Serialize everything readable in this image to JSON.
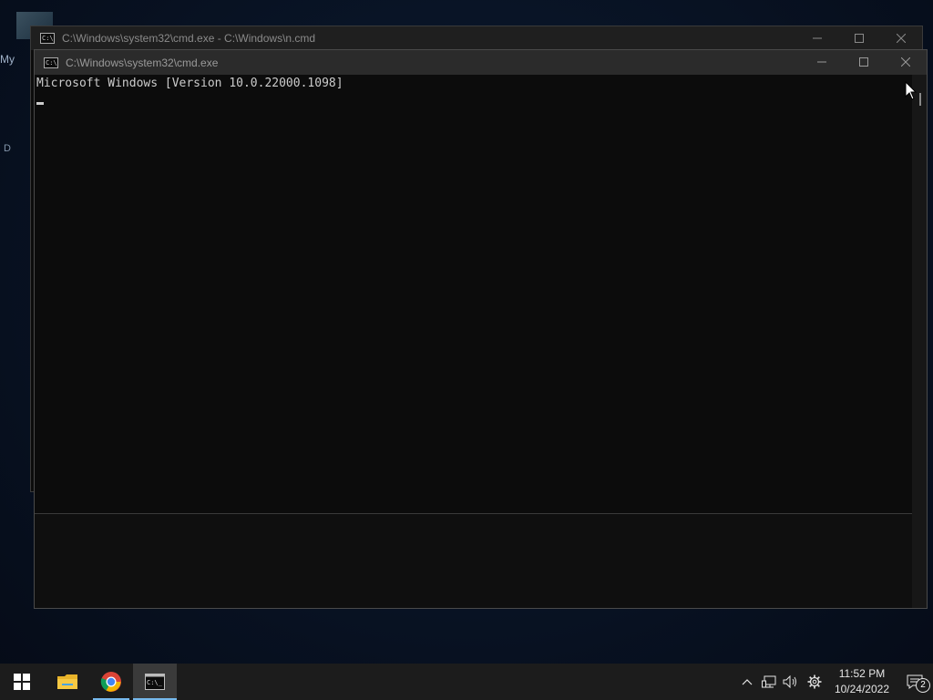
{
  "desktop": {
    "icon_label_1": "My",
    "icon_label_2": "D"
  },
  "back_window": {
    "title": "C:\\Windows\\system32\\cmd.exe - C:\\Windows\\n.cmd"
  },
  "front_window": {
    "title": "C:\\Windows\\system32\\cmd.exe",
    "console_lines": [
      "Microsoft Windows [Version 10.0.22000.1098]"
    ]
  },
  "taskbar": {
    "apps": [
      {
        "icon": "windows-start-icon"
      },
      {
        "icon": "file-explorer-icon"
      },
      {
        "icon": "chrome-icon"
      },
      {
        "icon": "command-prompt-icon"
      }
    ],
    "clock_time": "11:52 PM",
    "clock_date": "10/24/2022",
    "notification_count": "2"
  },
  "colors": {
    "accent": "#76b9ed",
    "console_bg": "#0c0c0c",
    "console_text": "#cccccc"
  }
}
